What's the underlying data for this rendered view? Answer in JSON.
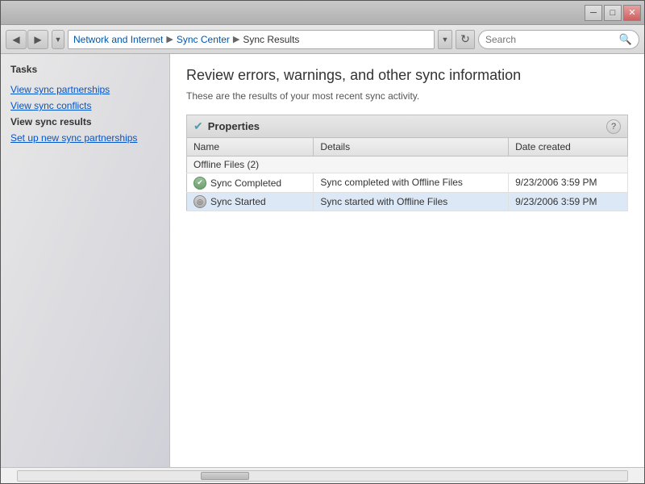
{
  "window": {
    "title_buttons": {
      "minimize": "─",
      "maximize": "□",
      "close": "✕"
    }
  },
  "address_bar": {
    "back_btn": "◀",
    "forward_btn": "▶",
    "dropdown_btn": "▼",
    "refresh_btn": "↻",
    "path": {
      "part1": "Network and Internet",
      "sep1": "▶",
      "part2": "Sync Center",
      "sep2": "▶",
      "part3": "Sync Results"
    },
    "search_placeholder": "Search"
  },
  "sidebar": {
    "section_title": "Tasks",
    "links": [
      {
        "id": "view-partnerships",
        "label": "View sync partnerships",
        "active": false
      },
      {
        "id": "view-conflicts",
        "label": "View sync conflicts",
        "active": false
      },
      {
        "id": "view-results",
        "label": "View sync results",
        "active": true
      },
      {
        "id": "setup-sync",
        "label": "Set up new sync partnerships",
        "active": false
      }
    ]
  },
  "content": {
    "title": "Review errors, warnings, and other sync information",
    "subtitle": "These are the results of your most recent sync activity.",
    "properties_label": "Properties",
    "help_label": "?",
    "table": {
      "columns": [
        "Name",
        "Details",
        "Date created"
      ],
      "group": "Offline Files (2)",
      "rows": [
        {
          "id": "sync-completed",
          "icon_type": "completed",
          "name": "Sync Completed",
          "details": "Sync completed with Offline Files",
          "date": "9/23/2006 3:59 PM",
          "highlighted": false
        },
        {
          "id": "sync-started",
          "icon_type": "started",
          "name": "Sync Started",
          "details": "Sync started with Offline Files",
          "date": "9/23/2006 3:59 PM",
          "highlighted": true
        }
      ]
    }
  }
}
